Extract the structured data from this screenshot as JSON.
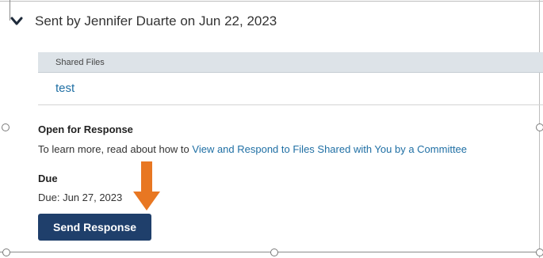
{
  "header": {
    "title": "Sent by Jennifer Duarte on Jun 22, 2023"
  },
  "files": {
    "header_label": "Shared Files",
    "items": [
      {
        "name": "test"
      }
    ]
  },
  "response": {
    "open_label": "Open for Response",
    "info_prefix": "To learn more, read about how to ",
    "info_link": "View and Respond to Files Shared with You by a Committee",
    "due_label": "Due",
    "due_text": "Due: Jun 27, 2023",
    "send_button_label": "Send Response"
  },
  "colors": {
    "accent": "#1f3f6b",
    "link": "#1f6fa4",
    "annotation_arrow": "#e87722"
  },
  "icons": {
    "collapse": "chevron-down-icon",
    "annotation": "arrow-down-icon"
  }
}
